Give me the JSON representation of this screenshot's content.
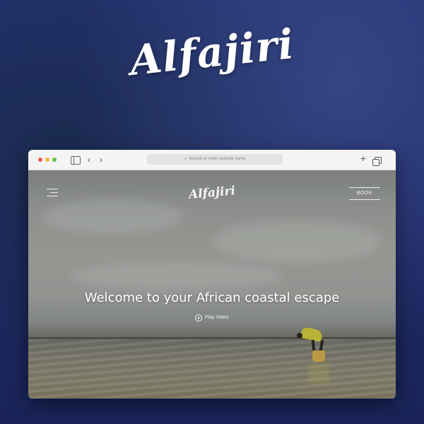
{
  "brand": {
    "title": "Alfajiri"
  },
  "browser": {
    "address_placeholder": "Search or enter website name",
    "icons": [
      "sidebar-icon",
      "chevron-left-icon",
      "chevron-right-icon",
      "plus-icon",
      "tabs-icon",
      "search-icon"
    ]
  },
  "site": {
    "logo": "Alfajiri",
    "book_label": "BOOK",
    "headline": "Welcome to your African coastal escape",
    "play_label": "Play Video"
  }
}
